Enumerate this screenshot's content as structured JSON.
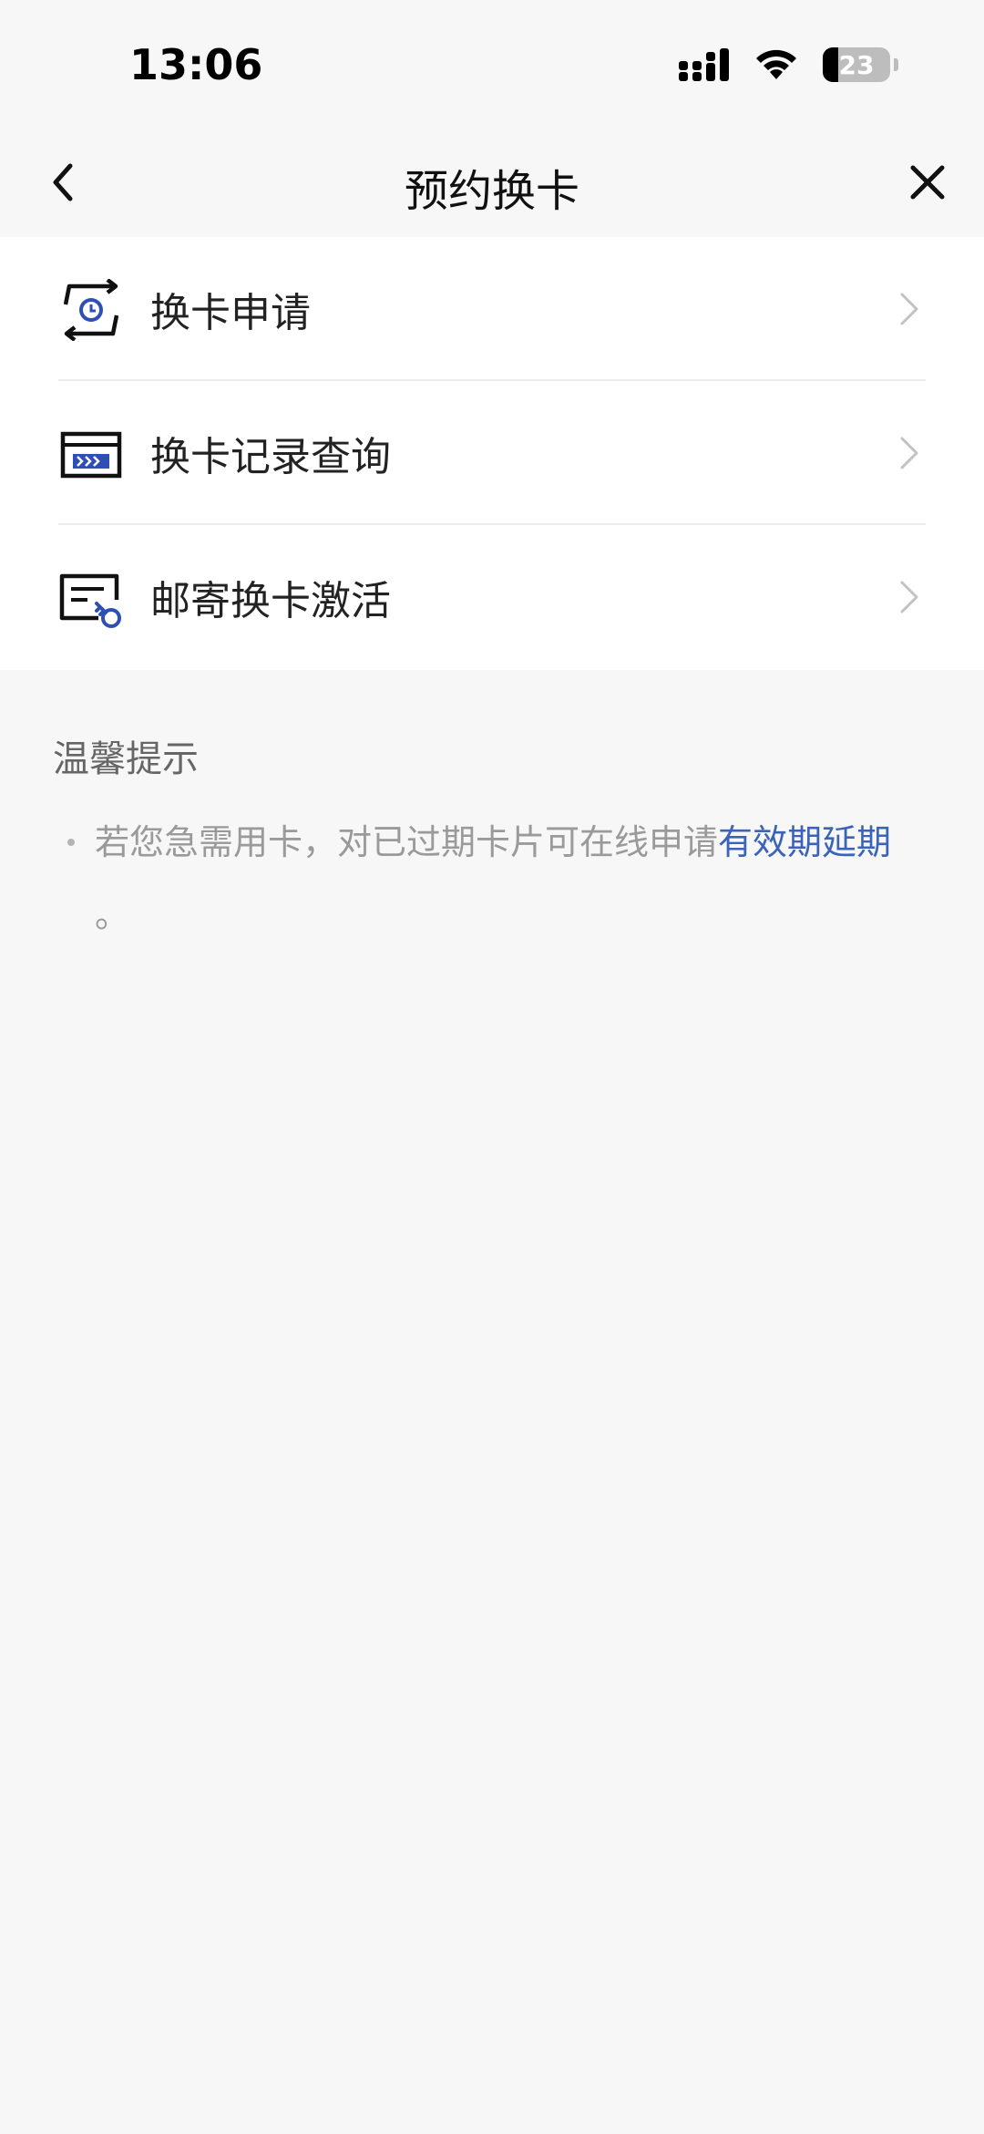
{
  "status_bar": {
    "time": "13:06",
    "battery_level": "23",
    "battery_fraction": 0.23,
    "icons": [
      "cellular-signal-icon",
      "wifi-icon",
      "battery-icon"
    ]
  },
  "nav": {
    "title": "预约换卡",
    "back_icon": "chevron-left-icon",
    "close_icon": "close-icon"
  },
  "menu": {
    "items": [
      {
        "label": "换卡申请",
        "icon": "card-exchange-icon"
      },
      {
        "label": "换卡记录查询",
        "icon": "card-record-icon"
      },
      {
        "label": "邮寄换卡激活",
        "icon": "card-activate-icon"
      }
    ]
  },
  "tips": {
    "title": "温馨提示",
    "text": "若您急需用卡，对已过期卡片可在线申请",
    "link": "有效期延期",
    "suffix": "。"
  },
  "colors": {
    "accent": "#3b63b8",
    "icon_blue": "#2e4fb5",
    "background": "#f7f7f7"
  }
}
